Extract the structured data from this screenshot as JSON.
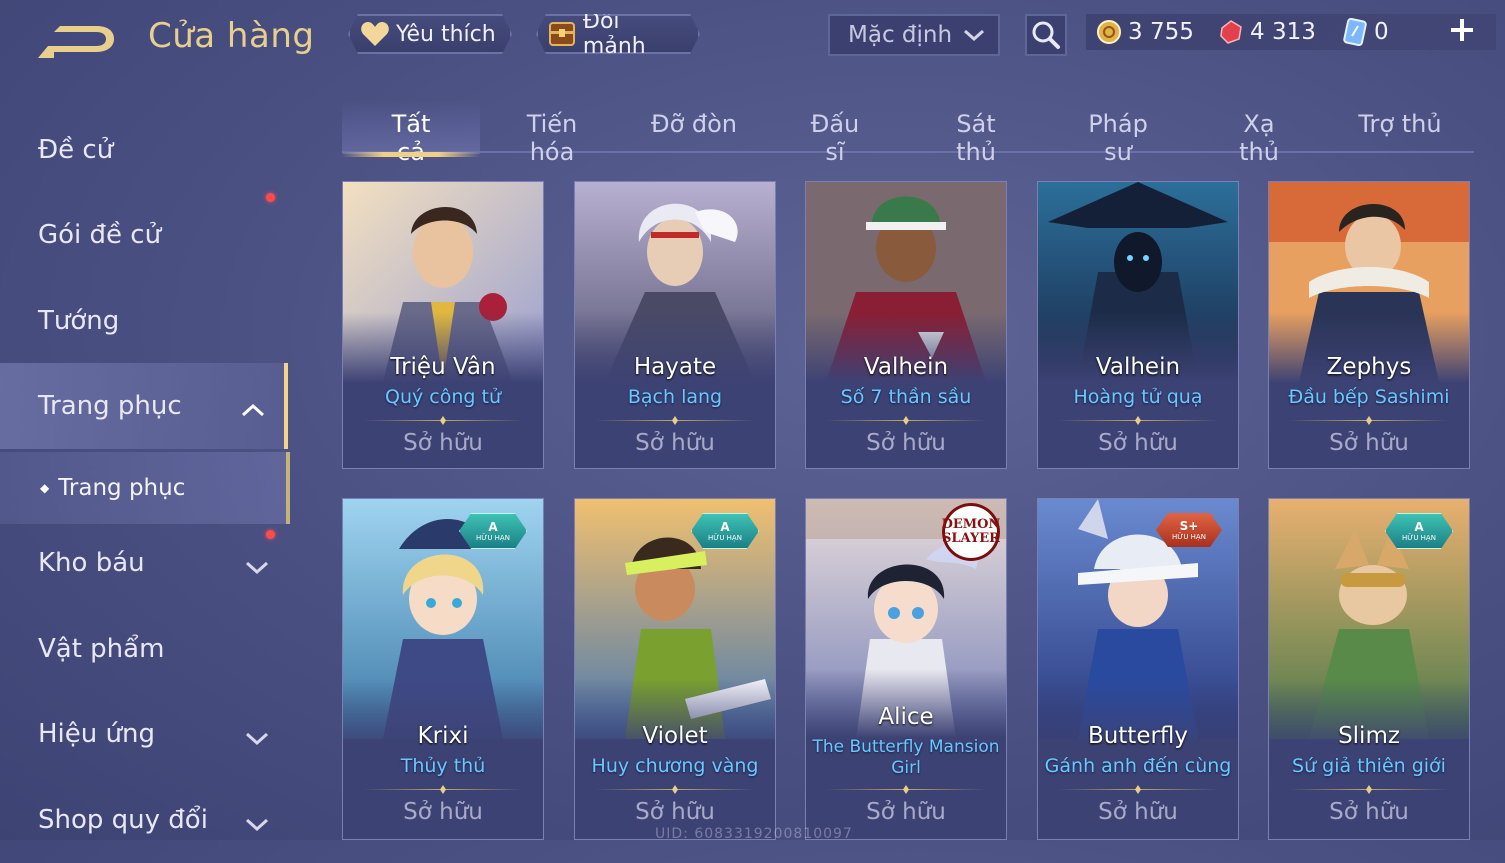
{
  "header": {
    "title": "Cửa hàng",
    "favorite_label": "Yêu thích",
    "exchange_label": "Đổi mảnh",
    "sort_value": "Mặc định",
    "currencies": {
      "gold": "3 755",
      "quan_huy": "4 313",
      "voucher": "0"
    }
  },
  "sidebar": {
    "items": [
      {
        "label": "Đề cử"
      },
      {
        "label": "Gói đề cử"
      },
      {
        "label": "Tướng"
      },
      {
        "label": "Trang phục"
      },
      {
        "label": "Kho báu"
      },
      {
        "label": "Vật phẩm"
      },
      {
        "label": "Hiệu ứng"
      },
      {
        "label": "Shop quy đổi"
      }
    ],
    "sub_item": "Trang phục"
  },
  "tabs": [
    "Tất cả",
    "Tiến hóa",
    "Đỡ đòn",
    "Đấu sĩ",
    "Sát thủ",
    "Pháp sư",
    "Xạ thủ",
    "Trợ thủ"
  ],
  "cards": [
    {
      "hero": "Triệu Vân",
      "skin": "Quý công tử",
      "status": "Sở hữu"
    },
    {
      "hero": "Hayate",
      "skin": "Bạch lang",
      "status": "Sở hữu"
    },
    {
      "hero": "Valhein",
      "skin": "Số 7 thần sầu",
      "status": "Sở hữu"
    },
    {
      "hero": "Valhein",
      "skin": "Hoàng tử quạ",
      "status": "Sở hữu"
    },
    {
      "hero": "Zephys",
      "skin": "Đầu bếp Sashimi",
      "status": "Sở hữu"
    },
    {
      "hero": "Krixi",
      "skin": "Thủy thủ",
      "status": "Sở hữu",
      "badge_tier": "A",
      "badge_text": "HỮU HẠN"
    },
    {
      "hero": "Violet",
      "skin": "Huy chương vàng",
      "status": "Sở hữu",
      "badge_tier": "A",
      "badge_text": "HỮU HẠN"
    },
    {
      "hero": "Alice",
      "skin_line1": "The Butterfly Mansion",
      "skin_line2": "Girl",
      "status": "Sở hữu",
      "collab_line1": "DEMON",
      "collab_line2": "SLAYER"
    },
    {
      "hero": "Butterfly",
      "skin": "Gánh anh đến cùng",
      "status": "Sở hữu",
      "badge_tier": "S+",
      "badge_text": "HỮU HẠN"
    },
    {
      "hero": "Slimz",
      "skin": "Sứ giả thiên giới",
      "status": "Sở hữu",
      "badge_tier": "A",
      "badge_text": "HỮU HẠN"
    }
  ],
  "footer": {
    "uid": "UID: 6083319200810097"
  },
  "colors": {
    "accent_gold": "#e9cf8e",
    "skin_name_blue": "#67c9ff",
    "notification_red": "#ff4a4a",
    "badge_teal": "#2a9e9c",
    "badge_red": "#c84a30"
  }
}
